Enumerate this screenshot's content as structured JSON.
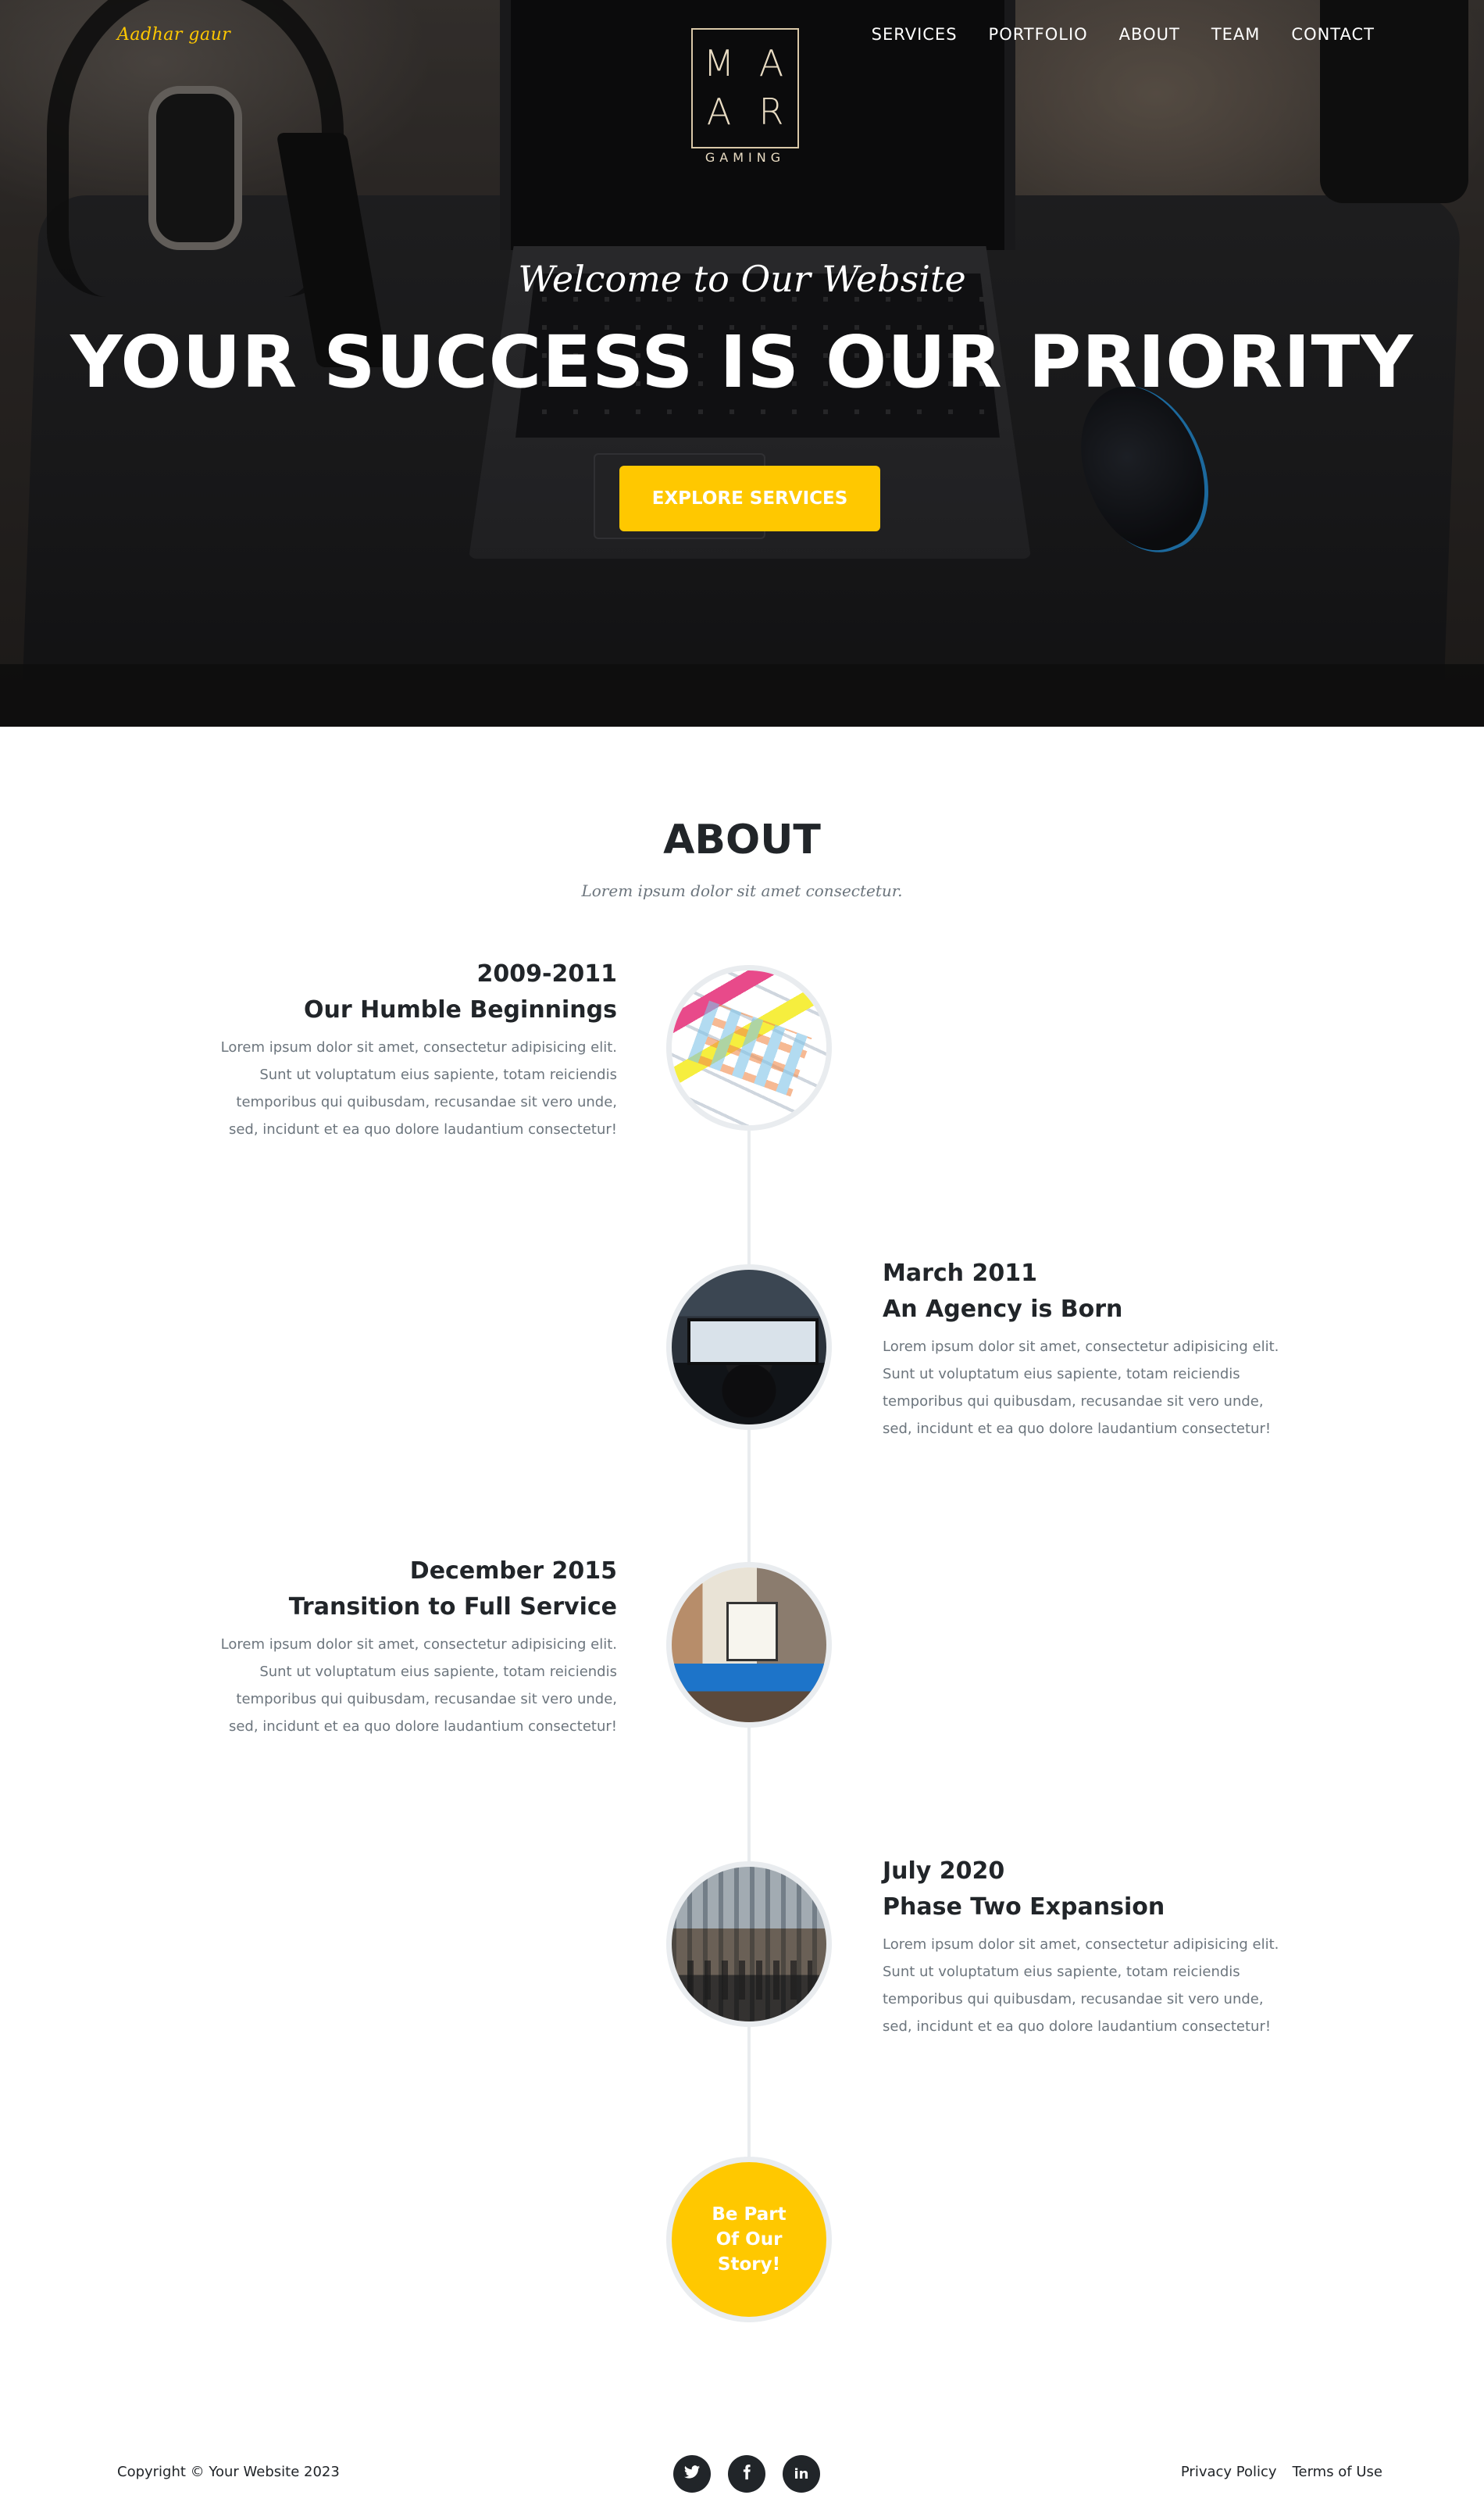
{
  "nav": {
    "brand": "Aadhar gaur",
    "logo_letters": [
      "M",
      "A",
      "A",
      "R"
    ],
    "logo_subtitle": "GAMING",
    "links": [
      "SERVICES",
      "PORTFOLIO",
      "ABOUT",
      "TEAM",
      "CONTACT"
    ]
  },
  "hero": {
    "subheading": "Welcome to Our Website",
    "heading": "YOUR SUCCESS IS OUR PRIORITY",
    "button_label": "EXPLORE SERVICES"
  },
  "about": {
    "title": "ABOUT",
    "subtitle": "Lorem ipsum dolor sit amet consectetur.",
    "timeline": [
      {
        "date": "2009-2011",
        "heading": "Our Humble Beginnings",
        "body": "Lorem ipsum dolor sit amet, consectetur adipisicing elit. Sunt ut voluptatum eius sapiente, totam reiciendis temporibus qui quibusdam, recusandae sit vero unde, sed, incidunt et ea quo dolore laudantium consectetur!"
      },
      {
        "date": "March 2011",
        "heading": "An Agency is Born",
        "body": "Lorem ipsum dolor sit amet, consectetur adipisicing elit. Sunt ut voluptatum eius sapiente, totam reiciendis temporibus qui quibusdam, recusandae sit vero unde, sed, incidunt et ea quo dolore laudantium consectetur!"
      },
      {
        "date": "December 2015",
        "heading": "Transition to Full Service",
        "body": "Lorem ipsum dolor sit amet, consectetur adipisicing elit. Sunt ut voluptatum eius sapiente, totam reiciendis temporibus qui quibusdam, recusandae sit vero unde, sed, incidunt et ea quo dolore laudantium consectetur!"
      },
      {
        "date": "July 2020",
        "heading": "Phase Two Expansion",
        "body": "Lorem ipsum dolor sit amet, consectetur adipisicing elit. Sunt ut voluptatum eius sapiente, totam reiciendis temporibus qui quibusdam, recusandae sit vero unde, sed, incidunt et ea quo dolore laudantium consectetur!"
      }
    ],
    "end_label": "Be Part Of Our Story!"
  },
  "footer": {
    "copyright": "Copyright © Your Website 2023",
    "socials": [
      "twitter-icon",
      "facebook-icon",
      "linkedin-icon"
    ],
    "linkedin_glyph": "in",
    "links": [
      "Privacy Policy",
      "Terms of Use"
    ]
  },
  "colors": {
    "accent": "#ffc800",
    "dark": "#212529",
    "muted": "#6c757d",
    "line": "#e9ecef"
  }
}
